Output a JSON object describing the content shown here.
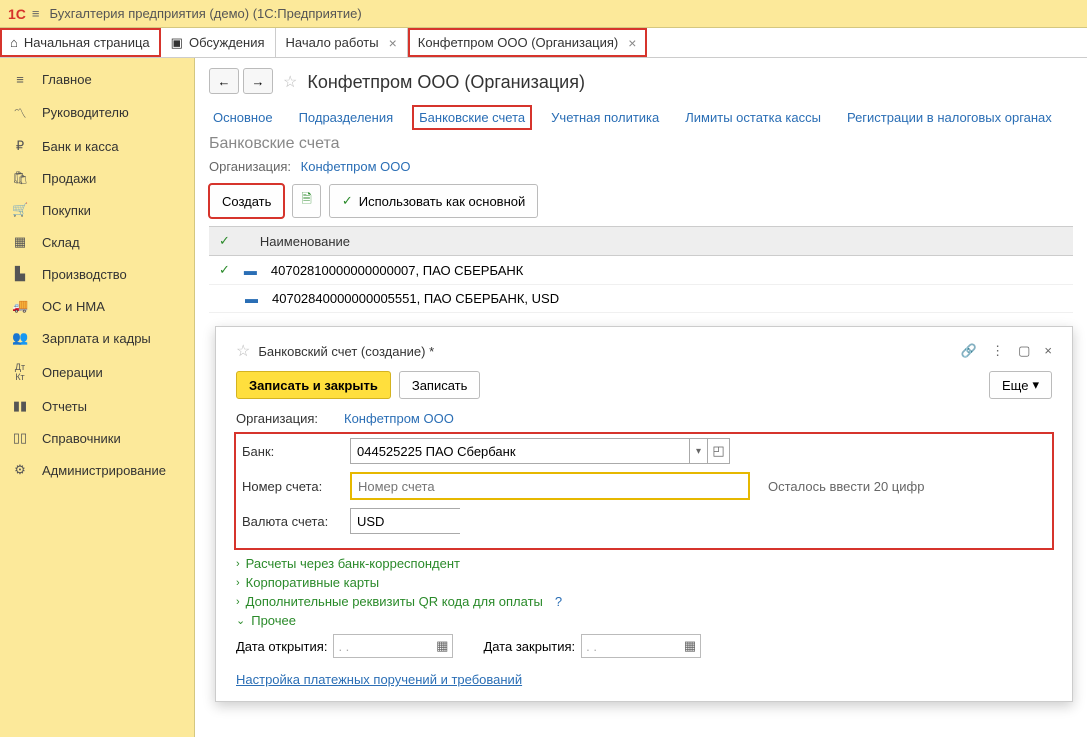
{
  "titlebar": {
    "app_name": "Бухгалтерия предприятия (демо)  (1С:Предприятие)"
  },
  "tabs": [
    {
      "label": "Начальная страница",
      "icon": "⌂",
      "closable": false,
      "highlight": true
    },
    {
      "label": "Обсуждения",
      "icon": "💬",
      "closable": false,
      "highlight": false
    },
    {
      "label": "Начало работы",
      "icon": "",
      "closable": true,
      "highlight": false
    },
    {
      "label": "Конфетпром ООО (Организация)",
      "icon": "",
      "closable": true,
      "highlight": true
    }
  ],
  "sidebar": [
    {
      "icon": "≡",
      "label": "Главное"
    },
    {
      "icon": "📈",
      "label": "Руководителю"
    },
    {
      "icon": "₽",
      "label": "Банк и касса"
    },
    {
      "icon": "🛍",
      "label": "Продажи"
    },
    {
      "icon": "🛒",
      "label": "Покупки"
    },
    {
      "icon": "🏭",
      "label": "Склад"
    },
    {
      "icon": "🏗",
      "label": "Производство"
    },
    {
      "icon": "🚚",
      "label": "ОС и НМА"
    },
    {
      "icon": "👥",
      "label": "Зарплата и кадры"
    },
    {
      "icon": "Дт",
      "label": "Операции"
    },
    {
      "icon": "📊",
      "label": "Отчеты"
    },
    {
      "icon": "📚",
      "label": "Справочники"
    },
    {
      "icon": "⚙",
      "label": "Администрирование"
    }
  ],
  "page": {
    "title": "Конфетпром ООО (Организация)",
    "subtabs": [
      "Основное",
      "Подразделения",
      "Банковские счета",
      "Учетная политика",
      "Лимиты остатка кассы",
      "Регистрации в налоговых органах"
    ],
    "section_title": "Банковские счета",
    "org_label": "Организация:",
    "org_value": "Конфетпром ООО",
    "toolbar": {
      "create": "Создать",
      "use_main": "Использовать как основной"
    },
    "table": {
      "header": "Наименование",
      "rows": [
        "40702810000000000007, ПАО СБЕРБАНК",
        "40702840000000005551, ПАО СБЕРБАНК, USD"
      ]
    }
  },
  "dialog": {
    "title": "Банковский счет (создание) *",
    "save_close": "Записать и закрыть",
    "save": "Записать",
    "more": "Еще",
    "org_label": "Организация:",
    "org_value": "Конфетпром ООО",
    "bank_label": "Банк:",
    "bank_value": "044525225 ПАО Сбербанк",
    "account_label": "Номер счета:",
    "account_placeholder": "Номер счета",
    "account_hint": "Осталось ввести 20 цифр",
    "currency_label": "Валюта счета:",
    "currency_value": "USD",
    "expanders": {
      "correspondent": "Расчеты через банк-корреспондент",
      "cards": "Корпоративные карты",
      "qr": "Дополнительные реквизиты QR кода для оплаты",
      "other": "Прочее"
    },
    "date_open_label": "Дата открытия:",
    "date_close_label": "Дата закрытия:",
    "date_placeholder": ".   .",
    "link": "Настройка платежных поручений и требований"
  }
}
